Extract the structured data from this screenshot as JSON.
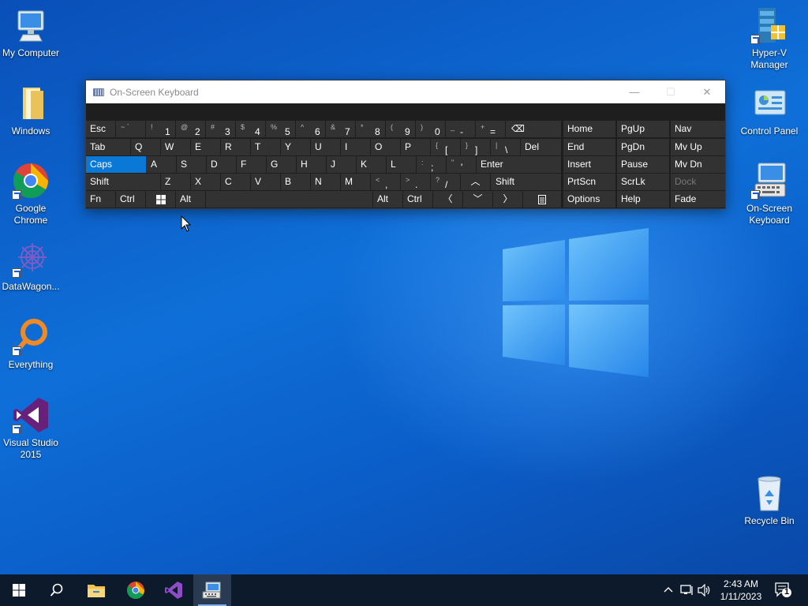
{
  "desktop": {
    "icons_left": [
      {
        "label": "My Computer",
        "icon": "monitor-icon"
      },
      {
        "label": "Windows",
        "icon": "folder-icon"
      },
      {
        "label": "Google Chrome",
        "icon": "chrome-icon"
      },
      {
        "label": "DataWagon...",
        "icon": "datawagon-icon"
      },
      {
        "label": "Everything",
        "icon": "everything-search-icon"
      },
      {
        "label": "Visual Studio 2015",
        "icon": "visual-studio-icon"
      }
    ],
    "icons_right": [
      {
        "label": "Hyper-V Manager",
        "icon": "hyperv-icon"
      },
      {
        "label": "Control Panel",
        "icon": "control-panel-icon"
      },
      {
        "label": "On-Screen Keyboard",
        "icon": "keyboard-icon"
      },
      {
        "label": "Recycle Bin",
        "icon": "recycle-bin-icon"
      }
    ]
  },
  "osk": {
    "title": "On-Screen Keyboard",
    "controls": {
      "minimize": "—",
      "maximize": "☐",
      "close": "✕"
    },
    "row1": {
      "esc": "Esc",
      "digits": [
        {
          "shift": "~ `",
          "main": ""
        },
        {
          "shift": "!",
          "main": "1"
        },
        {
          "shift": "@",
          "main": "2"
        },
        {
          "shift": "#",
          "main": "3"
        },
        {
          "shift": "$",
          "main": "4"
        },
        {
          "shift": "%",
          "main": "5"
        },
        {
          "shift": "^",
          "main": "6"
        },
        {
          "shift": "&",
          "main": "7"
        },
        {
          "shift": "*",
          "main": "8"
        },
        {
          "shift": "(",
          "main": "9"
        },
        {
          "shift": ")",
          "main": "0"
        },
        {
          "shift": "_",
          "main": "-"
        },
        {
          "shift": "+",
          "main": "="
        }
      ],
      "backspace": "⌫"
    },
    "row2": {
      "tab": "Tab",
      "letters": [
        "Q",
        "W",
        "E",
        "R",
        "T",
        "Y",
        "U",
        "I",
        "O",
        "P"
      ],
      "brackets": [
        {
          "shift": "{",
          "main": "["
        },
        {
          "shift": "}",
          "main": "]"
        },
        {
          "shift": "|",
          "main": "\\"
        }
      ],
      "del": "Del"
    },
    "row3": {
      "caps": "Caps",
      "letters": [
        "A",
        "S",
        "D",
        "F",
        "G",
        "H",
        "J",
        "K",
        "L"
      ],
      "punct": [
        {
          "shift": ":",
          "main": ";"
        },
        {
          "shift": "\"",
          "main": "'"
        }
      ],
      "enter": "Enter"
    },
    "row4": {
      "shift_left": "Shift",
      "letters": [
        "Z",
        "X",
        "C",
        "V",
        "B",
        "N",
        "M"
      ],
      "punct": [
        {
          "shift": "<",
          "main": ","
        },
        {
          "shift": ">",
          "main": "."
        },
        {
          "shift": "?",
          "main": "/"
        }
      ],
      "up_arrow": "︿",
      "shift_right": "Shift"
    },
    "row5": {
      "fn": "Fn",
      "ctrl_left": "Ctrl",
      "alt_left": "Alt",
      "alt_right": "Alt",
      "ctrl_right": "Ctrl",
      "left": "〈",
      "down": "﹀",
      "right": "〉"
    },
    "nav": {
      "col1": [
        "Home",
        "End",
        "Insert",
        "PrtScn",
        "Options"
      ],
      "col2": [
        "PgUp",
        "PgDn",
        "Pause",
        "ScrLk",
        "Help"
      ],
      "col3": [
        "Nav",
        "Mv Up",
        "Mv Dn",
        "Dock",
        "Fade"
      ]
    }
  },
  "taskbar": {
    "apps": [
      "start-icon",
      "search-icon",
      "file-explorer-icon",
      "chrome-icon",
      "visual-studio-icon",
      "on-screen-keyboard-icon"
    ],
    "clock_time": "2:43 AM",
    "clock_date": "1/11/2023",
    "notification_count": "1"
  },
  "colors": {
    "accent": "#0a78d7",
    "key_bg": "#323232",
    "osk_bg": "#1e1e1e",
    "taskbar": "#0d1a2c"
  }
}
